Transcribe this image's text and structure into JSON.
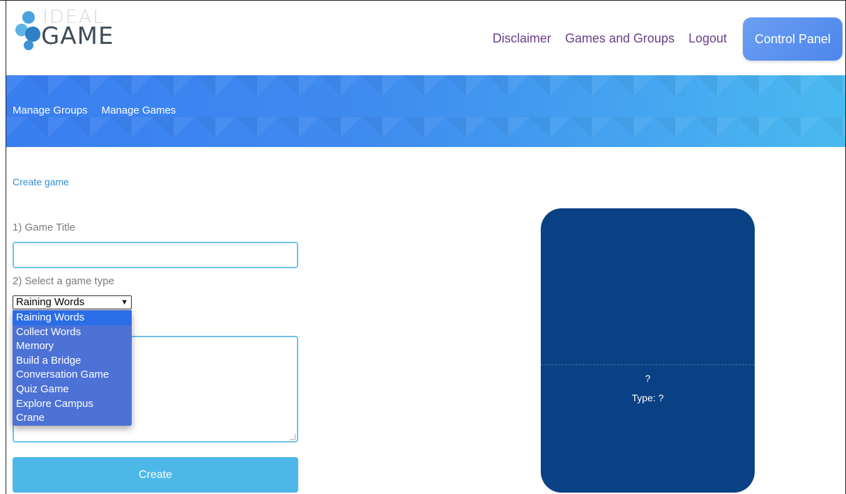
{
  "logo": {
    "line1": "IDEAL",
    "line2": "GAME"
  },
  "top_nav": {
    "disclaimer": "Disclaimer",
    "games_and_groups": "Games and Groups",
    "logout": "Logout",
    "control_panel": "Control Panel"
  },
  "sub_nav": {
    "manage_groups": "Manage Groups",
    "manage_games": "Manage Games"
  },
  "breadcrumb": "Create game",
  "form": {
    "game_title_label": "1) Game Title",
    "game_title_value": "",
    "game_type_label": "2) Select a game type",
    "game_type_selected": "Raining Words",
    "game_type_options": [
      "Raining Words",
      "Collect Words",
      "Memory",
      "Build a Bridge",
      "Conversation Game",
      "Quiz Game",
      "Explore Campus",
      "Crane"
    ],
    "create_button": "Create"
  },
  "preview": {
    "title": "?",
    "type": "Type: ?"
  },
  "colors": {
    "banner_start": "#3a7ef0",
    "banner_end": "#4ab9f0",
    "nav_link": "#6a3f8a",
    "card_bg": "#0a4184",
    "dropdown_bg": "#4d72d6",
    "dropdown_selected": "#2b6de6",
    "create_button": "#4db8e8"
  },
  "icons": {
    "logo": "droplets-logo-icon",
    "select_caret": "chevron-down-icon"
  }
}
